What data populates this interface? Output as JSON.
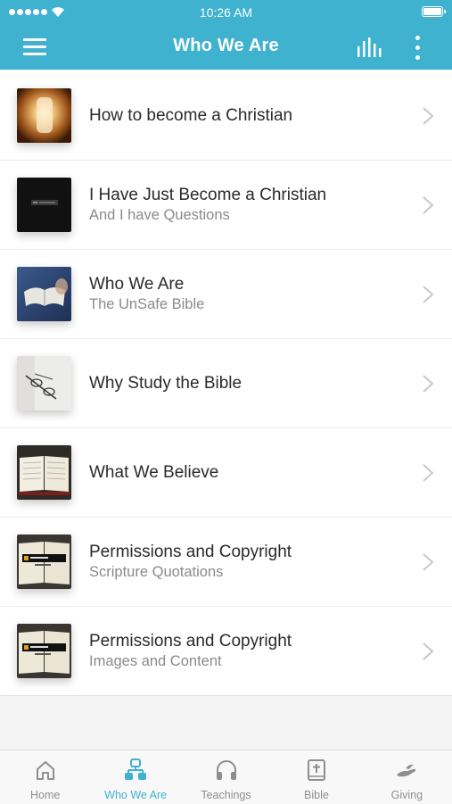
{
  "status_bar": {
    "time": "10:26 AM"
  },
  "nav": {
    "title": "Who We Are",
    "left_icon": "hamburger-menu-icon",
    "right_icons": [
      "audio-bars-icon",
      "more-vertical-icon"
    ]
  },
  "colors": {
    "primary": "#3fb2cf",
    "text": "#2a2a2a",
    "subtext": "#8a8a8a",
    "tab_inactive": "#8e8e8e"
  },
  "items": [
    {
      "title": "How to become a Christian",
      "subtitle": "",
      "thumbnail": "tunnel-light-image"
    },
    {
      "title": "I Have Just Become a Christian",
      "subtitle": "And I have Questions",
      "thumbnail": "dark-logo-image"
    },
    {
      "title": "Who We Are",
      "subtitle": "The UnSafe Bible",
      "thumbnail": "open-bible-hands-image"
    },
    {
      "title": "Why Study the Bible",
      "subtitle": "",
      "thumbnail": "glasses-on-page-image"
    },
    {
      "title": "What We Believe",
      "subtitle": "",
      "thumbnail": "open-bible-image"
    },
    {
      "title": "Permissions and Copyright",
      "subtitle": "Scripture Quotations",
      "thumbnail": "unsafe-bible-book-image"
    },
    {
      "title": "Permissions and Copyright",
      "subtitle": "Images and Content",
      "thumbnail": "unsafe-bible-book-image"
    }
  ],
  "tabs": [
    {
      "label": "Home",
      "icon": "house-icon",
      "active": false
    },
    {
      "label": "Who We Are",
      "icon": "people-network-icon",
      "active": true
    },
    {
      "label": "Teachings",
      "icon": "headphones-icon",
      "active": false
    },
    {
      "label": "Bible",
      "icon": "bible-cross-icon",
      "active": false
    },
    {
      "label": "Giving",
      "icon": "giving-hand-icon",
      "active": false
    }
  ]
}
